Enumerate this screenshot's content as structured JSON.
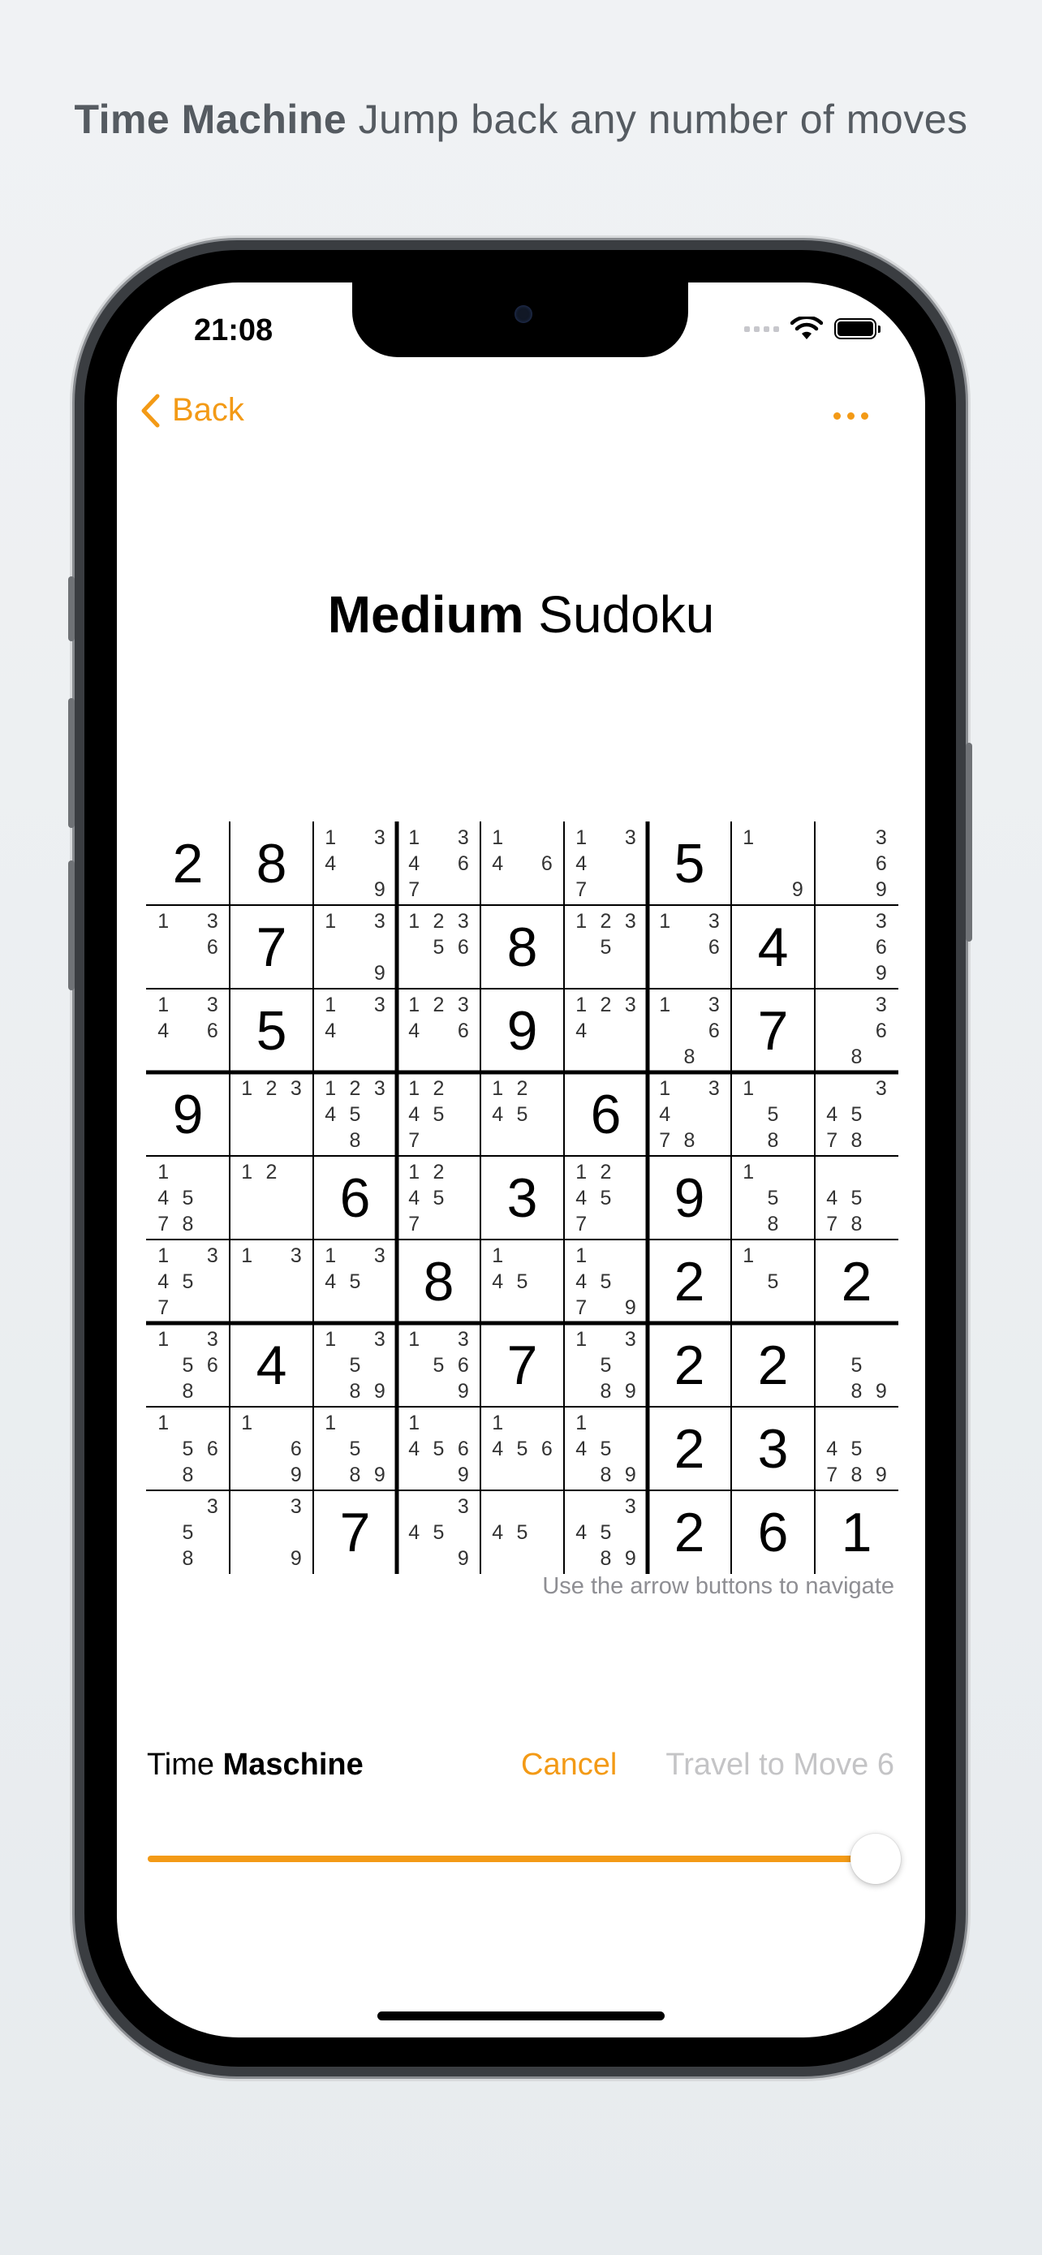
{
  "caption": {
    "bold": "Time Machine",
    "rest": "Jump back any number of moves"
  },
  "status_bar": {
    "time": "21:08",
    "icons": [
      "cellular-signal-icon",
      "wifi-icon",
      "battery-icon"
    ]
  },
  "nav": {
    "back_label": "Back",
    "more_icon": "ellipsis-icon"
  },
  "title": {
    "bold": "Medium",
    "rest": "Sudoku"
  },
  "board": [
    [
      {
        "v": "2"
      },
      {
        "v": "8"
      },
      {
        "n": [
          1,
          3,
          4,
          9
        ]
      },
      {
        "n": [
          1,
          3,
          4,
          6,
          7
        ]
      },
      {
        "n": [
          1,
          4,
          6
        ]
      },
      {
        "n": [
          1,
          3,
          4,
          7
        ]
      },
      {
        "v": "5"
      },
      {
        "n": [
          1,
          9
        ]
      },
      {
        "n": [
          3,
          6,
          9
        ]
      }
    ],
    [
      {
        "n": [
          1,
          3,
          6
        ]
      },
      {
        "v": "7"
      },
      {
        "n": [
          1,
          3,
          9
        ]
      },
      {
        "n": [
          1,
          2,
          3,
          5,
          6
        ]
      },
      {
        "v": "8"
      },
      {
        "n": [
          1,
          2,
          3,
          5
        ]
      },
      {
        "n": [
          1,
          3,
          6
        ]
      },
      {
        "v": "4"
      },
      {
        "n": [
          3,
          6,
          9
        ]
      }
    ],
    [
      {
        "n": [
          1,
          3,
          4,
          6
        ]
      },
      {
        "v": "5"
      },
      {
        "n": [
          1,
          3,
          4
        ]
      },
      {
        "n": [
          1,
          2,
          3,
          4,
          6
        ]
      },
      {
        "v": "9"
      },
      {
        "n": [
          1,
          2,
          3,
          4
        ]
      },
      {
        "n": [
          1,
          3,
          6,
          8
        ]
      },
      {
        "v": "7"
      },
      {
        "n": [
          3,
          6,
          8
        ]
      }
    ],
    [
      {
        "v": "9"
      },
      {
        "n": [
          1,
          2,
          3
        ]
      },
      {
        "n": [
          1,
          2,
          3,
          4,
          5,
          8
        ]
      },
      {
        "n": [
          1,
          2,
          4,
          5,
          7
        ]
      },
      {
        "n": [
          1,
          2,
          4,
          5
        ]
      },
      {
        "v": "6"
      },
      {
        "n": [
          1,
          3,
          4,
          7,
          8
        ]
      },
      {
        "n": [
          1,
          5,
          8
        ]
      },
      {
        "n": [
          3,
          4,
          5,
          7,
          8
        ]
      }
    ],
    [
      {
        "n": [
          1,
          4,
          5,
          7,
          8
        ]
      },
      {
        "n": [
          1,
          2
        ]
      },
      {
        "v": "6"
      },
      {
        "n": [
          1,
          2,
          4,
          5,
          7
        ]
      },
      {
        "v": "3"
      },
      {
        "n": [
          1,
          2,
          4,
          5,
          7
        ]
      },
      {
        "v": "9"
      },
      {
        "n": [
          1,
          5,
          8
        ]
      },
      {
        "n": [
          4,
          5,
          7,
          8
        ]
      }
    ],
    [
      {
        "n": [
          1,
          3,
          4,
          5,
          7
        ]
      },
      {
        "n": [
          1,
          3
        ]
      },
      {
        "n": [
          1,
          3,
          4,
          5
        ]
      },
      {
        "v": "8"
      },
      {
        "n": [
          1,
          4,
          5
        ]
      },
      {
        "n": [
          1,
          4,
          5,
          7,
          9
        ]
      },
      {
        "v": "2"
      },
      {
        "n": [
          1,
          5
        ]
      },
      {
        "v": "2"
      }
    ],
    [
      {
        "n": [
          1,
          3,
          5,
          6,
          8
        ]
      },
      {
        "v": "4"
      },
      {
        "n": [
          1,
          3,
          5,
          8,
          9
        ]
      },
      {
        "n": [
          1,
          3,
          5,
          6,
          9
        ]
      },
      {
        "v": "7"
      },
      {
        "n": [
          1,
          3,
          5,
          8,
          9
        ]
      },
      {
        "v": "2"
      },
      {
        "v": "2"
      },
      {
        "n": [
          5,
          8,
          9
        ]
      }
    ],
    [
      {
        "n": [
          1,
          5,
          6,
          8
        ]
      },
      {
        "n": [
          1,
          6,
          9
        ]
      },
      {
        "n": [
          1,
          5,
          8,
          9
        ]
      },
      {
        "n": [
          1,
          4,
          5,
          6,
          9
        ]
      },
      {
        "n": [
          1,
          4,
          5,
          6
        ]
      },
      {
        "n": [
          1,
          4,
          5,
          8,
          9
        ]
      },
      {
        "v": "2"
      },
      {
        "v": "3"
      },
      {
        "n": [
          4,
          5,
          7,
          8,
          9
        ]
      }
    ],
    [
      {
        "n": [
          3,
          5,
          8
        ]
      },
      {
        "n": [
          3,
          9
        ]
      },
      {
        "v": "7"
      },
      {
        "n": [
          3,
          4,
          5,
          9
        ]
      },
      {
        "n": [
          4,
          5
        ]
      },
      {
        "n": [
          3,
          4,
          5,
          8,
          9
        ]
      },
      {
        "v": "2"
      },
      {
        "v": "6"
      },
      {
        "v": "1"
      }
    ]
  ],
  "hint": "Use the arrow buttons to navigate",
  "time_machine": {
    "label_plain": "Time",
    "label_bold": "Maschine",
    "cancel_label": "Cancel",
    "travel_label": "Travel to Move 6",
    "slider_value": 1.0
  },
  "colors": {
    "accent": "#f39a16",
    "disabled": "#c4c4c6"
  }
}
